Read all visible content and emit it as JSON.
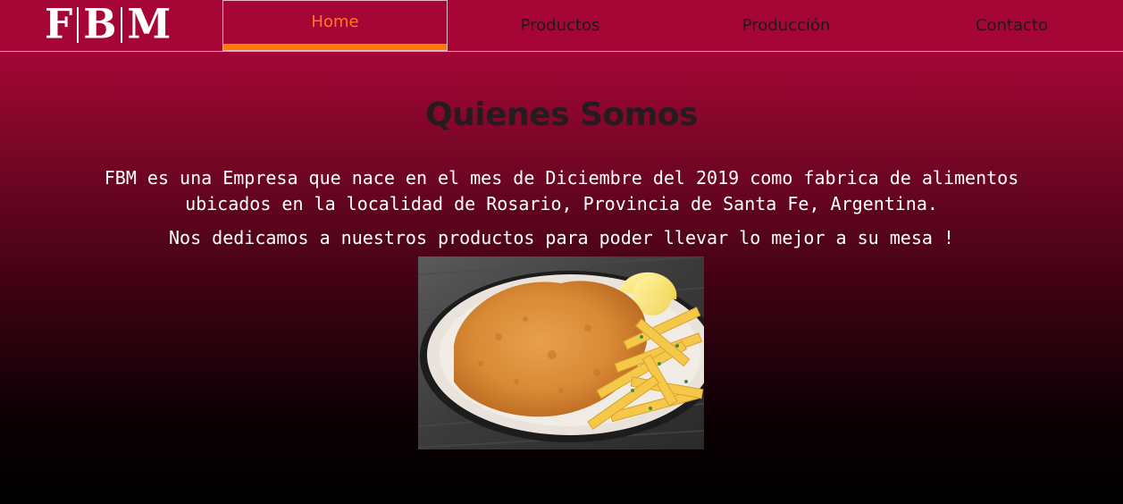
{
  "brand": {
    "logo_letters": [
      "F",
      "B",
      "M"
    ]
  },
  "nav": {
    "items": [
      {
        "label": "Home",
        "active": true
      },
      {
        "label": "Productos",
        "active": false
      },
      {
        "label": "Producción",
        "active": false
      },
      {
        "label": "Contacto",
        "active": false
      }
    ]
  },
  "main": {
    "title": "Quienes Somos",
    "paragraph_1": "FBM es una Empresa que nace en el mes de Diciembre del 2019 como fabrica de alimentos ubicados en la localidad de Rosario, Provincia de Santa Fe, Argentina.",
    "paragraph_2": "Nos dedicamos a nuestros productos para poder llevar lo mejor a su mesa !"
  },
  "colors": {
    "brand_red": "#a50636",
    "active_orange": "#ff7a00",
    "title_dark": "#241c20"
  }
}
